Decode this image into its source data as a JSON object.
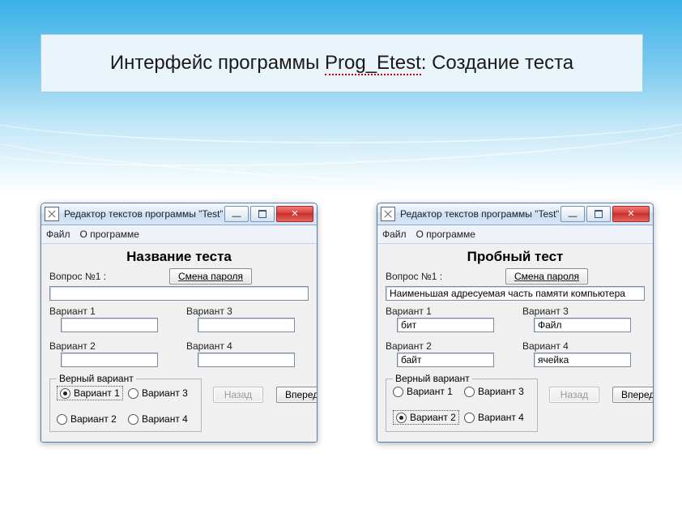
{
  "slide_title_parts": {
    "pre": "Интерфейс программы ",
    "mid": "Prog_Etest",
    "post": ": Создание теста"
  },
  "windows": [
    {
      "id": "left",
      "title": "Редактор текстов программы \"Test\"",
      "menu": {
        "file": "Файл",
        "about": "О программе"
      },
      "test_header": "Название теста",
      "question_label": "Вопрос №1 :",
      "change_password": "Смена пароля",
      "question_value": "",
      "variants": {
        "v1_label": "Вариант 1",
        "v1_value": "",
        "v2_label": "Вариант 2",
        "v2_value": "",
        "v3_label": "Вариант 3",
        "v3_value": "",
        "v4_label": "Вариант 4",
        "v4_value": ""
      },
      "correct_group": {
        "legend": "Верный вариант",
        "r1": "Вариант 1",
        "r2": "Вариант 2",
        "r3": "Вариант 3",
        "r4": "Вариант 4",
        "selected": 1
      },
      "nav": {
        "back": "Назад",
        "back_disabled": true,
        "forward": "Вперед"
      }
    },
    {
      "id": "right",
      "title": "Редактор текстов программы \"Test\"",
      "menu": {
        "file": "Файл",
        "about": "О программе"
      },
      "test_header": "Пробный тест",
      "question_label": "Вопрос №1 :",
      "change_password": "Смена пароля",
      "question_value": "Наименьшая адресуемая часть памяти компьютера",
      "variants": {
        "v1_label": "Вариант 1",
        "v1_value": "бит",
        "v2_label": "Вариант 2",
        "v2_value": "байт",
        "v3_label": "Вариант 3",
        "v3_value": "Файл",
        "v4_label": "Вариант 4",
        "v4_value": "ячейка"
      },
      "correct_group": {
        "legend": "Верный вариант",
        "r1": "Вариант 1",
        "r2": "Вариант 2",
        "r3": "Вариант 3",
        "r4": "Вариант 4",
        "selected": 2
      },
      "nav": {
        "back": "Назад",
        "back_disabled": true,
        "forward": "Вперед"
      }
    }
  ]
}
